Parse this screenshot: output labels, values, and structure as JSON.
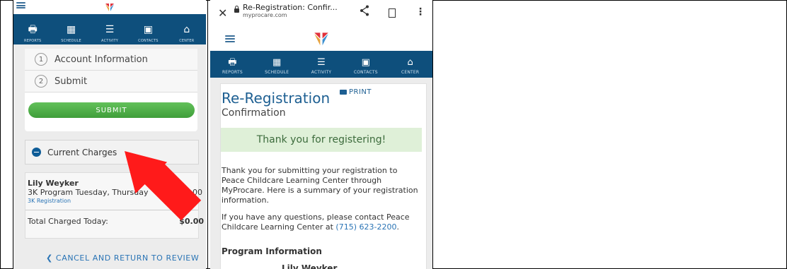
{
  "left_screen": {
    "nav": [
      {
        "label": "REPORTS",
        "icon": "printer-icon",
        "glyph": "🖶"
      },
      {
        "label": "SCHEDULE",
        "icon": "calendar-icon",
        "glyph": "▦"
      },
      {
        "label": "ACTIVITY",
        "icon": "list-icon",
        "glyph": "☰"
      },
      {
        "label": "CONTACTS",
        "icon": "contact-card-icon",
        "glyph": "▣"
      },
      {
        "label": "CENTER",
        "icon": "building-icon",
        "glyph": "⌂"
      }
    ],
    "steps": [
      {
        "num": "1",
        "label": "Account Information"
      },
      {
        "num": "2",
        "label": "Submit"
      }
    ],
    "submit_label": "SUBMIT",
    "charges_label": "Current Charges",
    "charge": {
      "name": "Lily Weyker",
      "program": "3K Program Tuesday, Thursday",
      "amount": "$0.00",
      "link": "3K Registration"
    },
    "total_label": "Total Charged Today:",
    "total_amount": "$0.00",
    "cancel_label": "CANCEL AND RETURN TO REVIEW"
  },
  "right_screen": {
    "browser": {
      "title": "Re-Registration: Confir...",
      "url": "myprocare.com"
    },
    "nav": [
      {
        "label": "REPORTS",
        "icon": "printer-icon",
        "glyph": "🖶"
      },
      {
        "label": "SCHEDULE",
        "icon": "calendar-icon",
        "glyph": "▦"
      },
      {
        "label": "ACTIVITY",
        "icon": "list-icon",
        "glyph": "☰"
      },
      {
        "label": "CONTACTS",
        "icon": "contact-card-icon",
        "glyph": "▣"
      },
      {
        "label": "CENTER",
        "icon": "building-icon",
        "glyph": "⌂"
      }
    ],
    "page_title": "Re-Registration",
    "print_label": "PRINT",
    "subtitle": "Confirmation",
    "thanks": "Thank you for registering!",
    "paragraph1": "Thank you for submitting your registration to Peace Childcare Learning Center through MyProcare. Here is a summary of your registration information.",
    "paragraph2_prefix": "If you have any questions, please contact Peace Childcare Learning Center at ",
    "phone": "(715) 623-2200",
    "paragraph2_suffix": ".",
    "program_heading": "Program Information",
    "child_name": "Lily Weyker"
  },
  "colors": {
    "nav_bg": "#0e4f7c",
    "accent_blue": "#1d5f92",
    "submit_green": "#4caf46",
    "success_bg": "#dff0d8",
    "arrow_red": "#ff1a1a"
  }
}
